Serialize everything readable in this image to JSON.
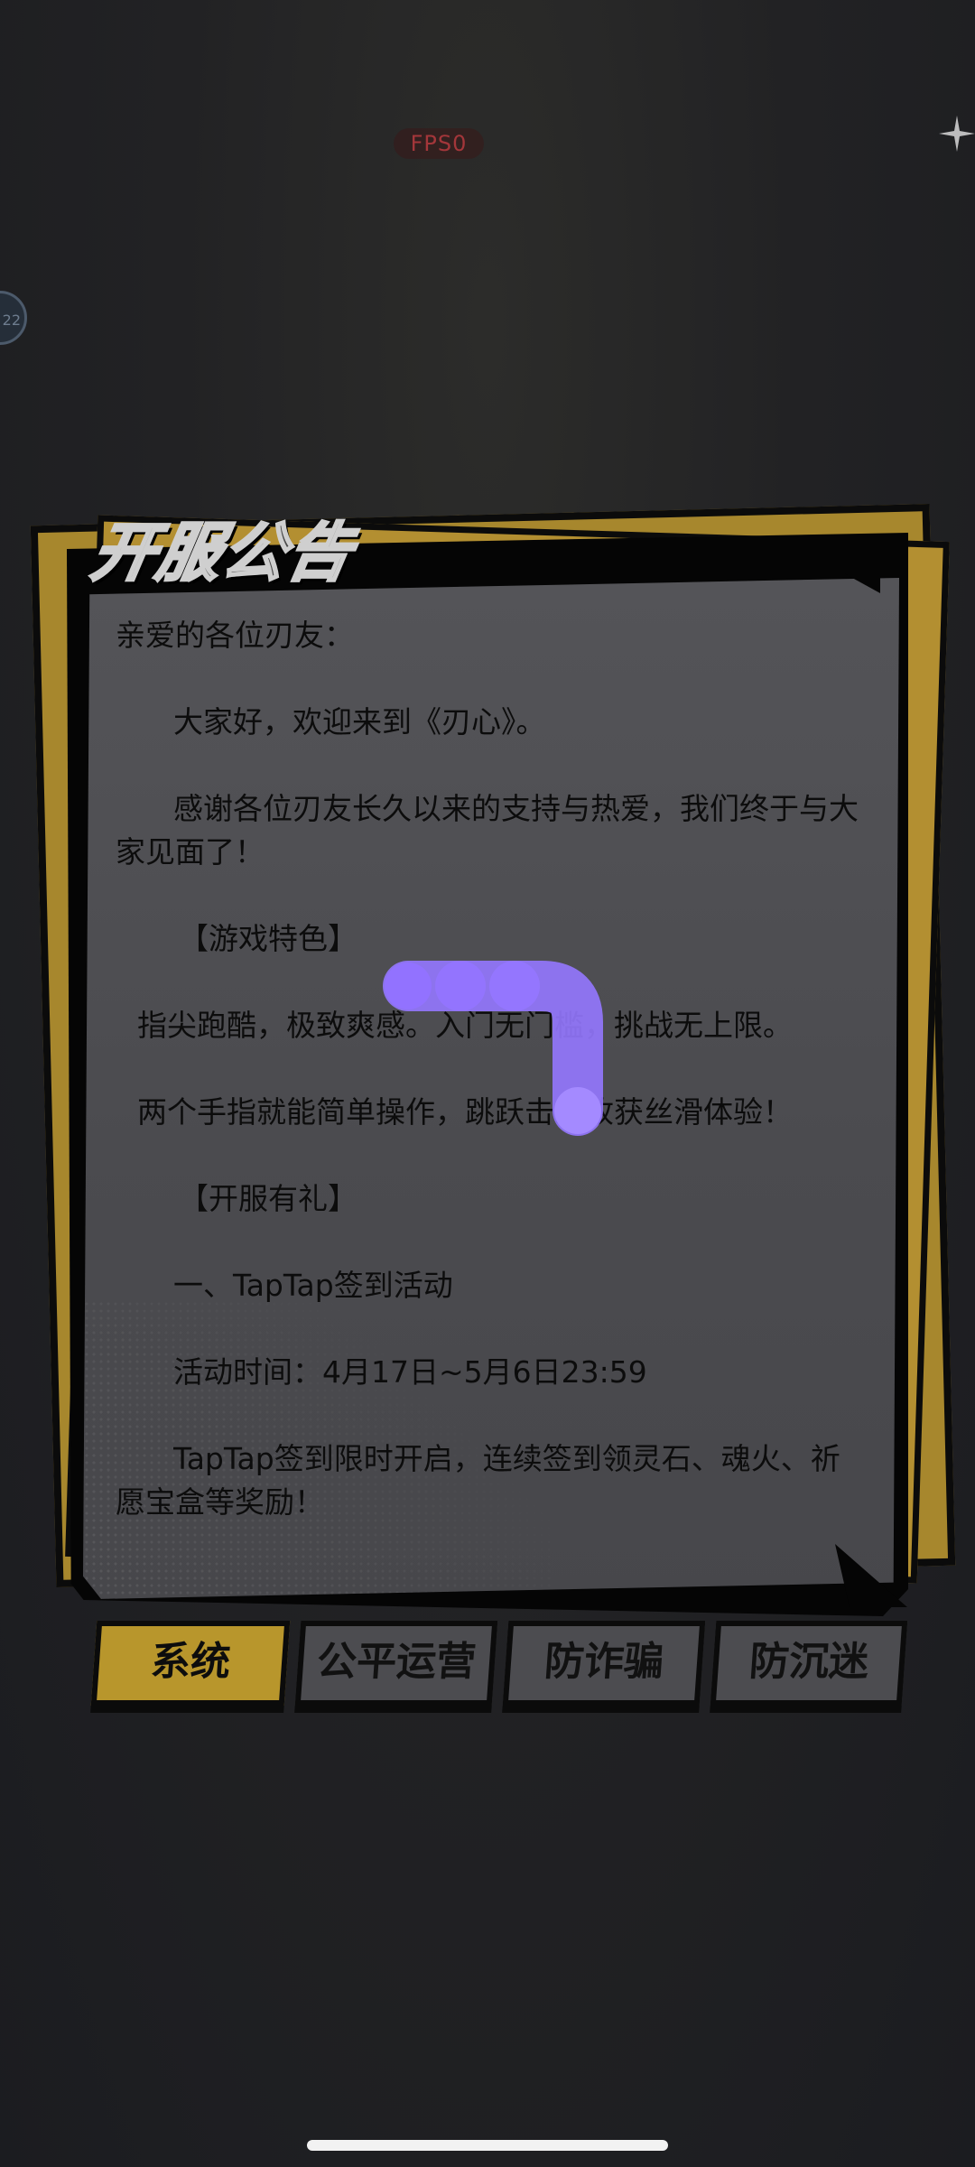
{
  "status": {
    "fps_label": "FPS0",
    "side_bubble_text": "22"
  },
  "announcement": {
    "title": "开服公告",
    "greeting": "亲爱的各位刃友：",
    "welcome": "大家好，欢迎来到《刃心》。",
    "thanks": "感谢各位刃友长久以来的支持与热爱，我们终于与大家见面了！",
    "section_features": "【游戏特色】",
    "feature_1": "指尖跑酷，极致爽感。入门无门槛，挑战无上限。",
    "feature_2": "两个手指就能简单操作，跳跃击杀收获丝滑体验！",
    "section_gifts": "【开服有礼】",
    "event_title": "一、TapTap签到活动",
    "event_time": "活动时间：4月17日~5月6日23:59",
    "event_desc": "TapTap签到限时开启，连续签到领灵石、魂火、祈愿宝盒等奖励！"
  },
  "tabs": [
    {
      "label": "系统",
      "active": true
    },
    {
      "label": "公平运营",
      "active": false
    },
    {
      "label": "防诈骗",
      "active": false
    },
    {
      "label": "防沉迷",
      "active": false
    }
  ],
  "colors": {
    "background": "#1e1e21",
    "panel": "#4d4d51",
    "accent_yellow": "#b8962c",
    "gesture_purple": "#8a5cff"
  },
  "icons": {
    "sparkle": "sparkle-icon",
    "gesture": "swipe-gesture-trail"
  }
}
